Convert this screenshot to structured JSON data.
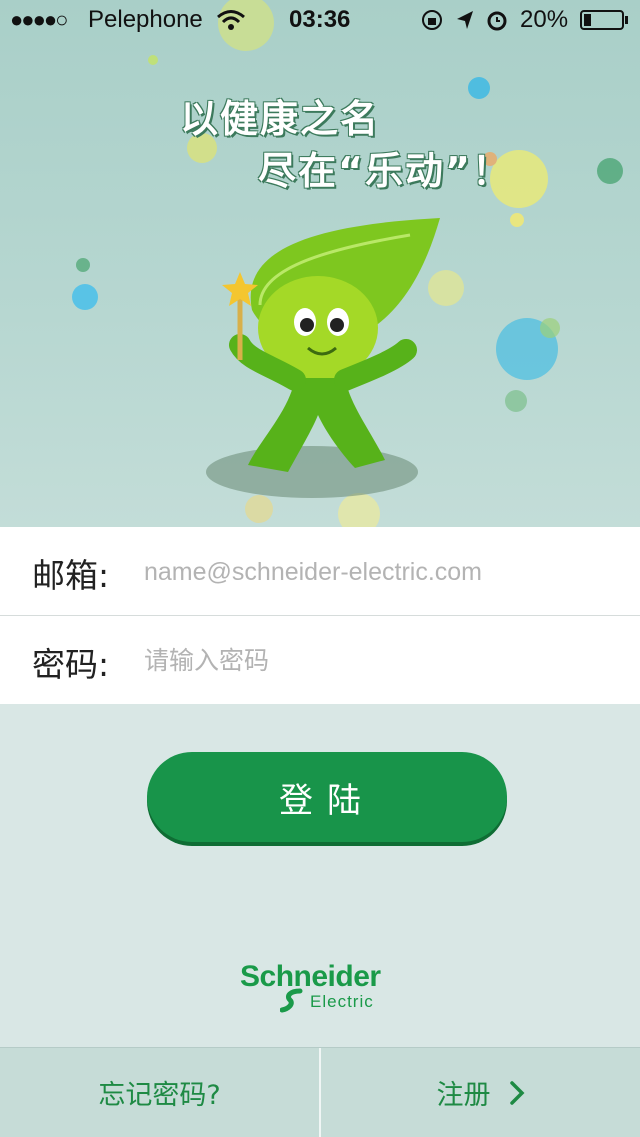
{
  "status_bar": {
    "signal": "●●●●○",
    "carrier": "Pelephone",
    "time": "03:36",
    "battery_percent": "20%",
    "battery_level": 0.2
  },
  "hero": {
    "slogan_line1": "以健康之名",
    "slogan_line2": "尽在“乐动”！"
  },
  "form": {
    "email_label": "邮箱:",
    "email_placeholder": "name@schneider-electric.com",
    "password_label": "密码:",
    "password_placeholder": "请输入密码"
  },
  "login_button": "登陆",
  "brand": {
    "name": "Schneider",
    "sub": "Electric"
  },
  "footer": {
    "forgot": "忘记密码?",
    "register": "注册"
  },
  "colors": {
    "accent": "#18944a",
    "text_green": "#1e8a44"
  }
}
